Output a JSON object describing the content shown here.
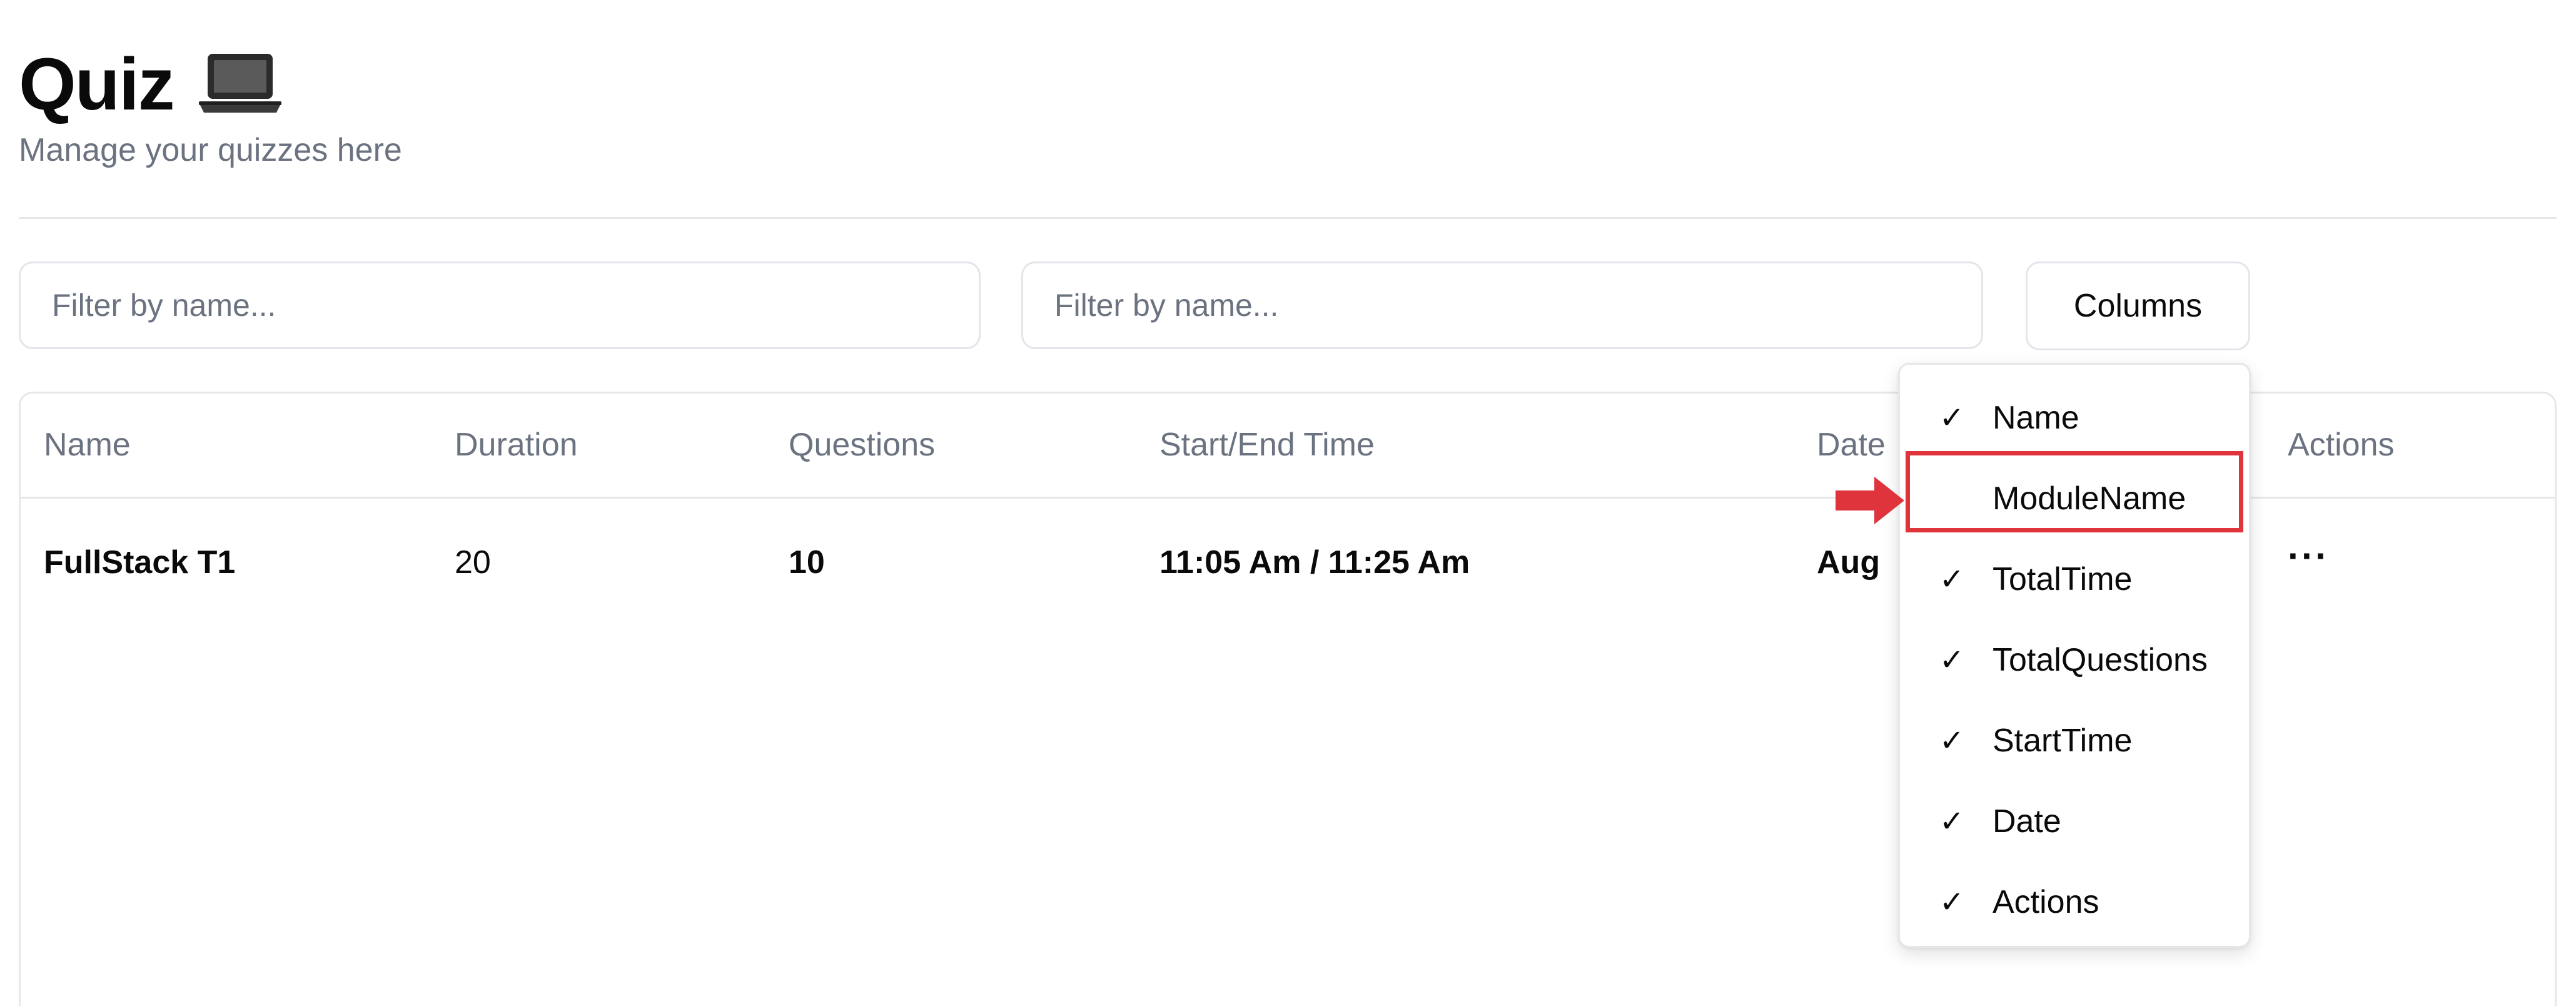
{
  "header": {
    "title": "Quiz",
    "title_icon": "laptop-icon",
    "subtitle": "Manage your quizzes here"
  },
  "filters": {
    "first_placeholder": "Filter by name...",
    "second_placeholder": "Filter by name...",
    "columns_button_label": "Columns"
  },
  "table": {
    "headers": {
      "name": "Name",
      "duration": "Duration",
      "questions": "Questions",
      "start_end_time": "Start/End Time",
      "date": "Date",
      "actions": "Actions"
    },
    "rows": [
      {
        "name": "FullStack T1",
        "duration": "20",
        "questions": "10",
        "start_end_time": "11:05 Am / 11:25 Am",
        "date": "Aug",
        "actions_icon": "more-horizontal-icon"
      }
    ]
  },
  "columns_menu": {
    "items": [
      {
        "label": "Name",
        "checked": true,
        "check_glyph": "✓"
      },
      {
        "label": "ModuleName",
        "checked": false,
        "check_glyph": ""
      },
      {
        "label": "TotalTime",
        "checked": true,
        "check_glyph": "✓"
      },
      {
        "label": "TotalQuestions",
        "checked": true,
        "check_glyph": "✓"
      },
      {
        "label": "StartTime",
        "checked": true,
        "check_glyph": "✓"
      },
      {
        "label": "Date",
        "checked": true,
        "check_glyph": "✓"
      },
      {
        "label": "Actions",
        "checked": true,
        "check_glyph": "✓"
      }
    ]
  },
  "annotation": {
    "highlight_color": "#e0343c",
    "arrow_icon": "red-arrow-right-icon"
  },
  "colors": {
    "muted_text": "#6b7280",
    "border": "#e5e7eb",
    "text": "#0a0a0a"
  }
}
